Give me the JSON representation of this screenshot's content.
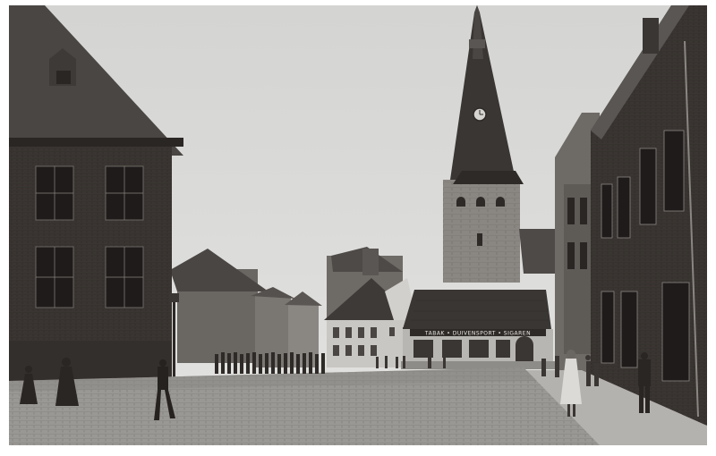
{
  "photo": {
    "style": "monochrome",
    "colors": {
      "sky": "#d9d9d7",
      "brick_dark": "#2a2624",
      "brick_mid": "#4a4642",
      "stone": "#8c8884",
      "roof": "#3a3634",
      "cobble": "#9a9894",
      "pavement": "#b4b2ae"
    }
  },
  "shop_sign": {
    "text": "TABAK • DUIVENSPORT • SIGAREN"
  }
}
